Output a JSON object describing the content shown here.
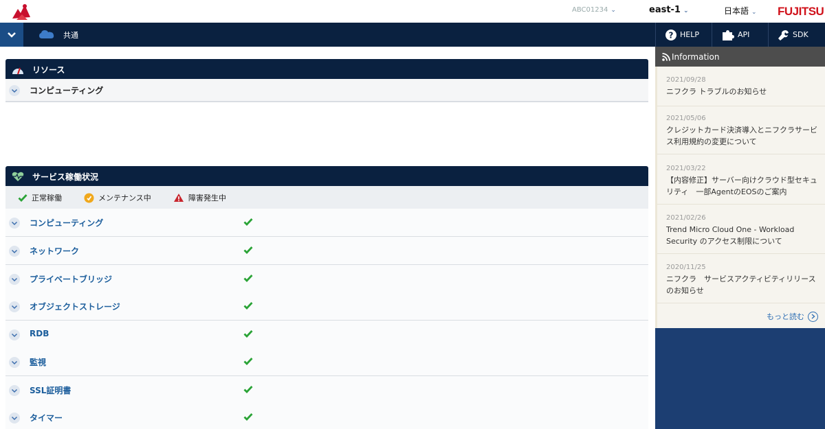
{
  "header": {
    "account": "ABC01234",
    "region": "east-1",
    "language": "日本語",
    "brand": "FUJITSU"
  },
  "nav": {
    "title": "共通",
    "help": "HELP",
    "api": "API",
    "sdk": "SDK"
  },
  "resources": {
    "title": "リソース",
    "items": [
      {
        "label": "コンピューティング"
      }
    ]
  },
  "service_status": {
    "title": "サービス稼働状況",
    "legend": {
      "normal": "正常稼働",
      "maintenance": "メンテナンス中",
      "incident": "障害発生中"
    },
    "items": [
      {
        "label": "コンピューティング",
        "status": "normal"
      },
      {
        "label": "ネットワーク",
        "status": "normal"
      },
      {
        "label": "プライベートブリッジ",
        "status": "normal"
      },
      {
        "label": "オブジェクトストレージ",
        "status": "normal"
      },
      {
        "label": "RDB",
        "status": "normal"
      },
      {
        "label": "監視",
        "status": "normal"
      },
      {
        "label": "SSL証明書",
        "status": "normal"
      },
      {
        "label": "タイマー",
        "status": "normal"
      }
    ]
  },
  "information": {
    "title": "Information",
    "items": [
      {
        "date": "2021/09/28",
        "title": "ニフクラ トラブルのお知らせ"
      },
      {
        "date": "2021/05/06",
        "title": "クレジットカード決済導入とニフクラサービス利用規約の変更について"
      },
      {
        "date": "2021/03/22",
        "title": "【内容修正】サーバー向けクラウド型セキュリティ　一部AgentのEOSのご案内"
      },
      {
        "date": "2021/02/26",
        "title": "Trend Micro Cloud One - Workload Security のアクセス制限について"
      },
      {
        "date": "2020/11/25",
        "title": "ニフクラ　サービスアクティビティリリースのお知らせ"
      }
    ],
    "more": "もっと読む"
  },
  "colors": {
    "navy": "#0a2140",
    "ok_green": "#2aa336",
    "link_blue": "#1c5e9c",
    "brand_red": "#d0121b"
  }
}
